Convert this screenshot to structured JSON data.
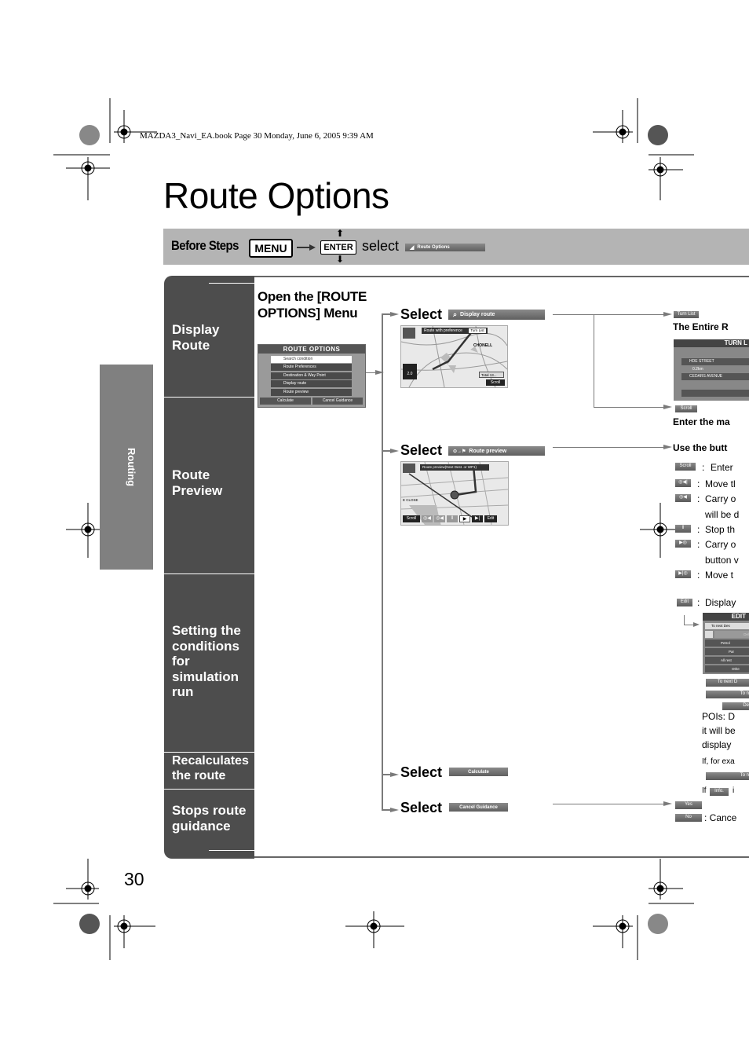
{
  "print_header": "MAZDA3_Navi_EA.book  Page 30  Monday, June 6, 2005  9:39 AM",
  "page_title": "Route Options",
  "before_steps": {
    "label": "Before Steps",
    "key_menu": "MENU",
    "key_enter": "ENTER",
    "select_word": "select",
    "target_button": "Route Options"
  },
  "side_tab": "Routing",
  "categories": [
    {
      "label": "Display Route"
    },
    {
      "label": "Route Preview"
    },
    {
      "label": "Setting the conditions for simulation run"
    },
    {
      "label": "Recalculates the route"
    },
    {
      "label": "Stops route guidance"
    }
  ],
  "open_menu": {
    "heading": "Open the [ROUTE OPTIONS] Menu",
    "screen_title": "ROUTE OPTIONS",
    "items": [
      "Search condition",
      "Route Preferences",
      "Destination & Way Point",
      "Display route",
      "Route preview"
    ],
    "footer": [
      "Calculate",
      "Cancel Guidance"
    ]
  },
  "steps": [
    {
      "select": "Select",
      "button": "Display route",
      "map_header": "Route with preference",
      "map_btn": "Turn List",
      "map_place": "CHONELL",
      "map_total": "Total  13...",
      "map_scroll": "Scroll",
      "map_scale": "2.0"
    },
    {
      "select": "Select",
      "button": "Route preview",
      "map_header": "Route preview(Next Dest. or WP1)",
      "controls": [
        "Scroll",
        "",
        "",
        "",
        "",
        "",
        "Edit"
      ],
      "map_street": "E CLOSE"
    },
    {
      "select": "Select",
      "button": "Calculate"
    },
    {
      "select": "Select",
      "button": "Cancel Guidance"
    }
  ],
  "right": {
    "turn_list_btn": "Turn List",
    "entire_route_text": "The Entire R",
    "turn_list_title": "TURN L",
    "turn_rows": [
      "HDE STREET",
      "0.2km",
      "CEDARS AVENUE"
    ],
    "scroll_btn": "Scroll",
    "enter_text": "Enter the ma",
    "use_buttons_text": "Use the butt",
    "button_rows": [
      {
        "btn": "Scroll",
        "colon": ":",
        "text": "Enter"
      },
      {
        "btn": "◎◀|",
        "colon": ":",
        "text": "Move tl"
      },
      {
        "btn": "◎◀",
        "colon": ":",
        "text": "Carry o"
      },
      {
        "btn": "",
        "colon": "",
        "text": "will be d"
      },
      {
        "btn": "‖",
        "colon": ":",
        "text": "Stop th"
      },
      {
        "btn": "▶◎",
        "colon": ":",
        "text": "Carry o"
      },
      {
        "btn": "",
        "colon": "",
        "text": "button v"
      },
      {
        "btn": "▶|◎",
        "colon": ":",
        "text": "Move t"
      }
    ],
    "edit_btn": "Edit",
    "edit_text": "Display",
    "edit_screen_title": "EDIT",
    "edit_rows": [
      "To next Des",
      "Del",
      "Petrol",
      "Par",
      "All rest",
      "Othe"
    ],
    "edit_buttons": [
      "To next D",
      "To n",
      "De"
    ],
    "pois_lines": [
      "POIs: D",
      "it will be",
      "display"
    ],
    "if_example": "If, for exa",
    "to_next_btn": "To n",
    "if_word": "If",
    "info_btn": "Info.",
    "info_after": "i",
    "yes_btn": "Yes",
    "no_btn": "No",
    "cancel_text": ": Cance"
  },
  "page_number": "30"
}
